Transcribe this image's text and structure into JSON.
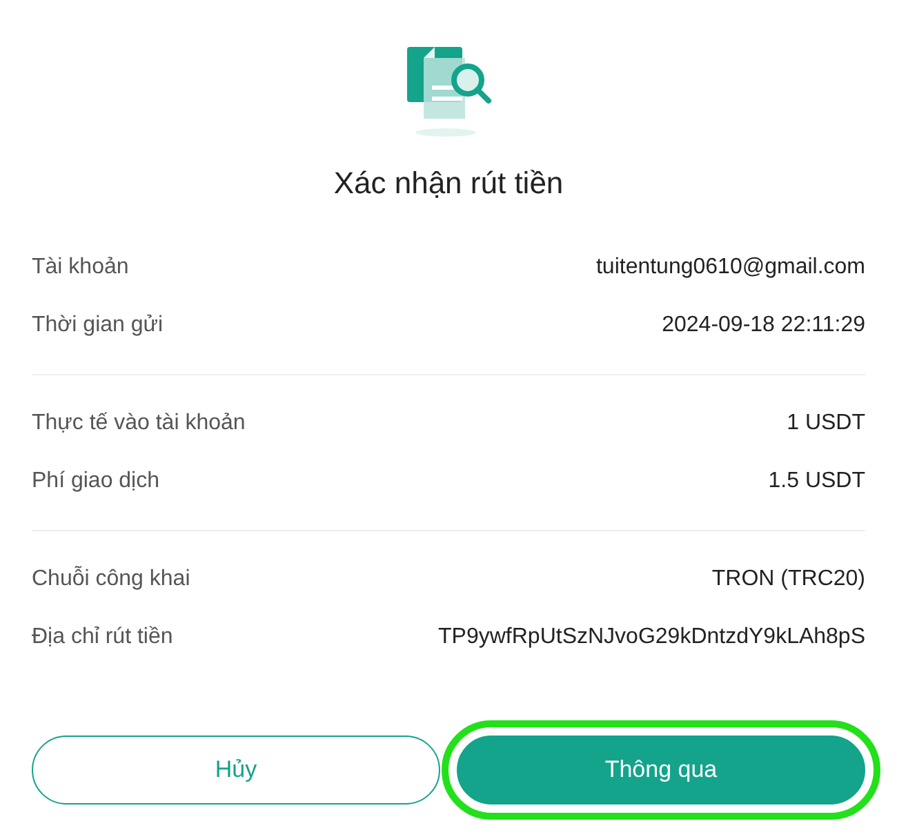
{
  "title": "Xác nhận rút tiền",
  "sections": [
    {
      "rows": [
        {
          "label": "Tài khoản",
          "value": "tuitentung0610@gmail.com"
        },
        {
          "label": "Thời gian gửi",
          "value": "2024-09-18 22:11:29"
        }
      ]
    },
    {
      "rows": [
        {
          "label": "Thực tế vào tài khoản",
          "value": "1 USDT"
        },
        {
          "label": "Phí giao dịch",
          "value": "1.5 USDT"
        }
      ]
    },
    {
      "rows": [
        {
          "label": "Chuỗi công khai",
          "value": "TRON (TRC20)"
        },
        {
          "label": "Địa chỉ rút tiền",
          "value": "TP9ywfRpUtSzNJvoG29kDntzdY9kLAh8pS"
        }
      ]
    }
  ],
  "buttons": [
    {
      "label": "Hủy",
      "kind": "outline",
      "highlighted": false
    },
    {
      "label": "Thông qua",
      "kind": "primary",
      "highlighted": true
    }
  ]
}
